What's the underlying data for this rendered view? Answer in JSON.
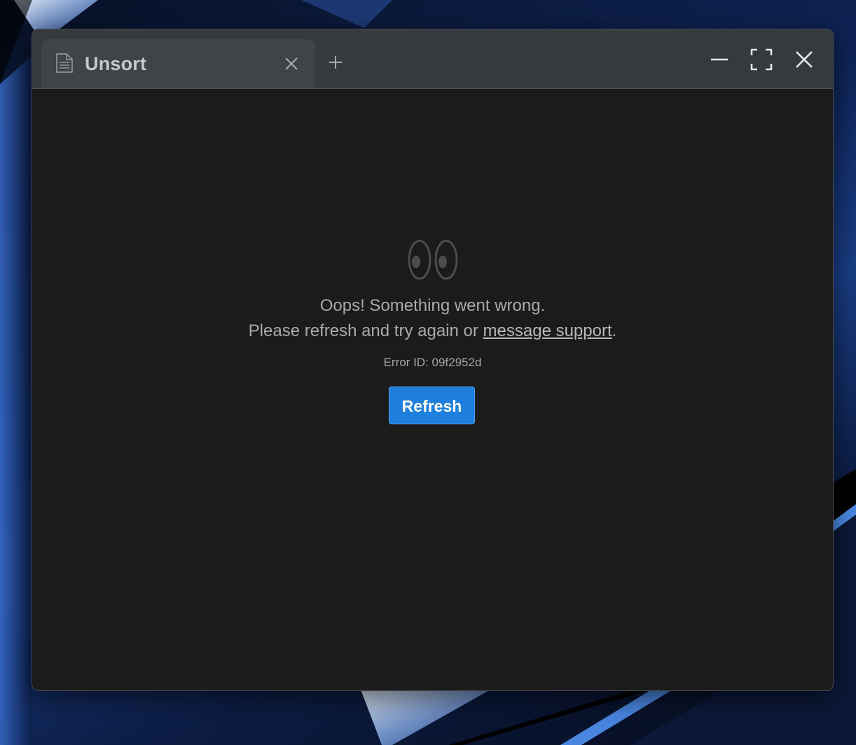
{
  "tab": {
    "title": "Unsort",
    "doc_icon": "document-icon",
    "close_icon": "close-icon",
    "new_tab_icon": "plus-icon"
  },
  "window_controls": {
    "minimize_icon": "minimize-icon",
    "maximize_icon": "fullscreen-icon",
    "close_icon": "close-icon"
  },
  "error": {
    "icon": "eyes-icon",
    "line1": "Oops! Something went wrong.",
    "line2_prefix": "Please refresh and try again or ",
    "support_link": "message support",
    "line2_suffix": ".",
    "error_id": "Error ID: 09f2952d",
    "refresh_label": "Refresh"
  },
  "colors": {
    "accent": "#1e7fdf",
    "titlebar": "#363a3e",
    "content_bg": "#1b1b1b"
  }
}
